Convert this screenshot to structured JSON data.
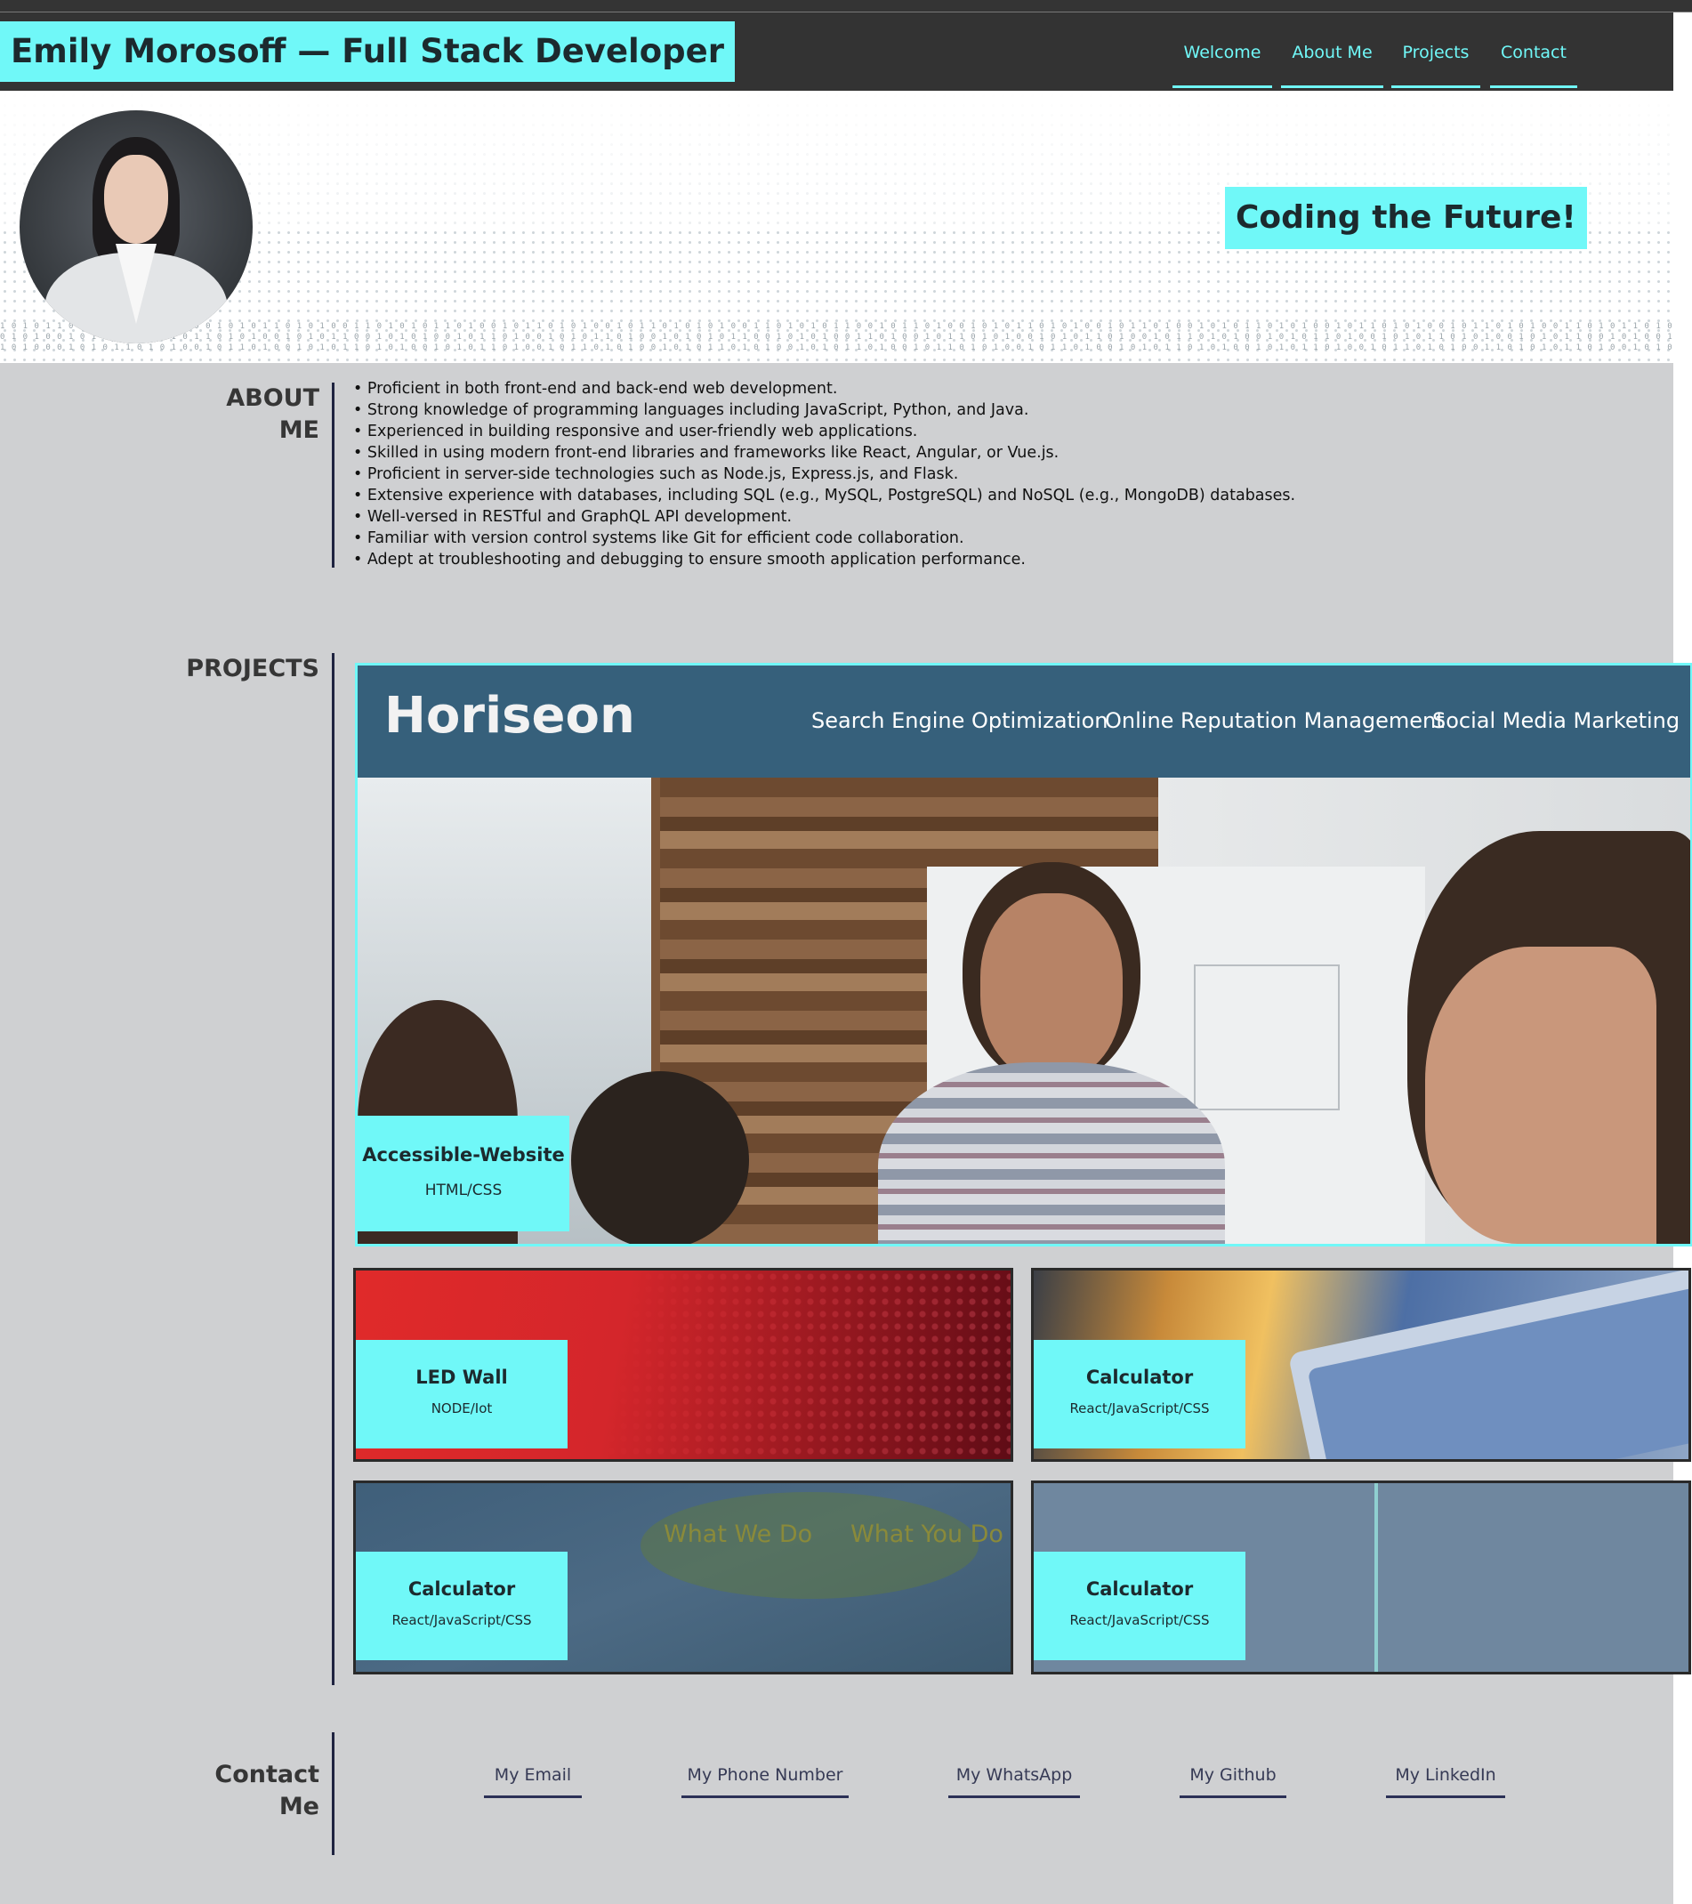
{
  "header": {
    "title": "Emily Morosoff — Full Stack Developer",
    "nav": [
      "Welcome",
      "About Me",
      "Projects",
      "Contact"
    ]
  },
  "hero": {
    "tagline": "Coding the Future!",
    "binary_lines": [
      "1 0 1 0 1 1 0 1 0 0 1 0 1 1 1 0 1 0 0 1 0 1 0 1 1 0 1 0 1 0 0 1 1 0 1 0 1 0 1 1 0 1 0 0 1 0 1 1 0 1 0 1 0 0 1 0 1 1 0 1 0 1 0 1 0 0 1 1 0 1 0 1 0 1 1 0 0 1 0 1 1 0 1 0 0 1 0 1 0 1 1 0 1 0 1 0 0 1 0 1 1 0 1 0 0 1 0 1 0 1 1 0 1 0 1 0 0 1 0 1 1 0 1 0 1 0 0 1 0 1 1 0 1 0 1 0 0 1 1 0 1 0 1 1 0 1 0 0 1 0 1 1 0 1 0 1 0 1 0 0 1 0 1 1 0 1 0 1 0 0 1 0 1 1 0 1 0 0 1 0 1 0 1",
      "0 1 0 1 0 0 1 0 1 1 0 1 0 0 0 1 0 1 1 0 1 0 1 0 0 1 0 1 0 1 1 0 0 1 0 1 0 1 0 0 1 0 1 1 0 1 0 0 1 0 1 0 1 1 0 1 0 0 1 0 1 0 1 0 1 1 0 0 1 0 1 0 1 0 0 1 1 0 1 0 0 1 0 1 1 0 1 0 1 0 0 1 0 1 0 1 1 0 1 0 0 1 0 1 1 0 1 0 1 0 0 1 0 1 0 1 1 0 1 0 0 1 0 1 0 1 1 0 1 0 1 0 0 1 0 1 0 1 1 0 0 1 0 1 0 0 1 0 1 1 0 1 0 1 0 1 1 0 1 0 0 1 0 1 0 1 1 0 1 0 0 1 0 1 1 0 1 0 1 0",
      "1 0 1 0 0 0 1 0 1 0 1 1 0 1 0 1 0 0 1 0 1 1 0 1 0 0 1 0 1 0 1 1 0 1 0 1 0 0 1 0 1 0 1 1 0 1 0 0 1 0 1 1 0 1 0 1 0 0 1 0 1 0 1 1 0 1 0 1 0 0 1 0 1 0 1 1 0 1 0 0 1 0 1 1 0 1 0 1 0 0 1 0 1 1 0 1 0 0 1 0 1 0 1 1 0 1 0 1 0 0 1 0 1 0 1 1 0 1 0 0 1 0 1 1 0 1 0 1 0 0 1 1 0 1 0 1 0 1 1 0 1 0 0 1 0 1 0 1 1 0 1 0 1 0 0 1 0 1 0 1 1 0 1 0 1 0 0 1 0 1 1 0 1 0 0 1 0 1 0 1"
    ]
  },
  "about": {
    "title_line1": "ABOUT",
    "title_line2": "ME",
    "items": [
      "Proficient in both front-end and back-end web development.",
      "Strong knowledge of programming languages including JavaScript, Python, and Java.",
      "Experienced in building responsive and user-friendly web applications.",
      "Skilled in using modern front-end libraries and frameworks like React, Angular, or Vue.js.",
      "Proficient in server-side technologies such as Node.js, Express.js, and Flask.",
      "Extensive experience with databases, including SQL (e.g., MySQL, PostgreSQL) and NoSQL (e.g., MongoDB) databases.",
      "Well-versed in RESTful and GraphQL API development.",
      "Familiar with version control systems like Git for efficient code collaboration.",
      "Adept at troubleshooting and debugging to ensure smooth application performance."
    ]
  },
  "projects": {
    "title": "PROJECTS",
    "featured": {
      "screenshot_logo": "Horiseon",
      "screenshot_nav": [
        "Search Engine Optimization",
        "Online Reputation Management",
        "Social Media Marketing"
      ],
      "name": "Accessible-Website",
      "tech": "HTML/CSS"
    },
    "cards": [
      {
        "name": "LED Wall",
        "tech": "NODE/Iot"
      },
      {
        "name": "Calculator",
        "tech": "React/JavaScript/CSS"
      },
      {
        "name": "Calculator",
        "tech": "React/JavaScript/CSS",
        "screenshot_text": [
          "What We Do",
          "What You Do"
        ]
      },
      {
        "name": "Calculator",
        "tech": "React/JavaScript/CSS"
      }
    ]
  },
  "contact": {
    "title_line1": "Contact",
    "title_line2": "Me",
    "links": [
      "My Email",
      "My Phone Number",
      "My WhatsApp",
      "My Github",
      "My LinkedIn"
    ]
  },
  "colors": {
    "accent": "#70f8f8",
    "header_bg": "#333333",
    "main_bg": "#cfd0d2",
    "divider": "#1f2340"
  }
}
